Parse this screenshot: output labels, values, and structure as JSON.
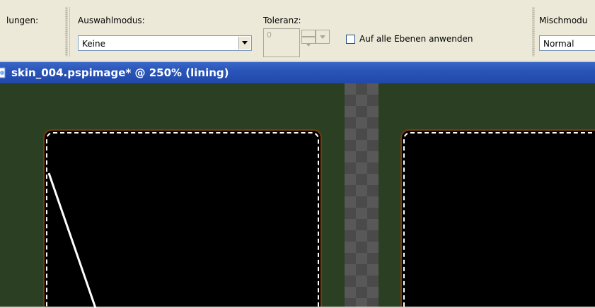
{
  "toolbar": {
    "partial_label": "lungen:",
    "selection_mode": {
      "label": "Auswahlmodus:",
      "value": "Keine"
    },
    "tolerance": {
      "label": "Toleranz:",
      "value": "0"
    },
    "all_layers_checkbox": {
      "label": "Auf alle Ebenen anwenden",
      "checked": false
    },
    "blend_mode": {
      "label": "Mischmodu",
      "value": "Normal"
    }
  },
  "document": {
    "title": "skin_004.pspimage* @ 250% (lining)"
  },
  "colors": {
    "canvas_background": "#2b3f22",
    "title_bar": "#2a55b8",
    "panel_fill": "#000000",
    "panel_border": "#7a3a0a",
    "selection_marquee": "#ffffff"
  }
}
